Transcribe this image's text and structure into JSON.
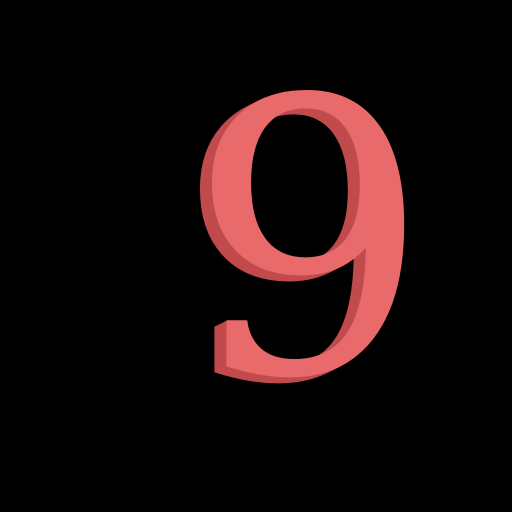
{
  "scene": {
    "digit": "9",
    "face_color": "#e86a6a",
    "side_color": "#c04a4c",
    "background_color": "#000000"
  }
}
